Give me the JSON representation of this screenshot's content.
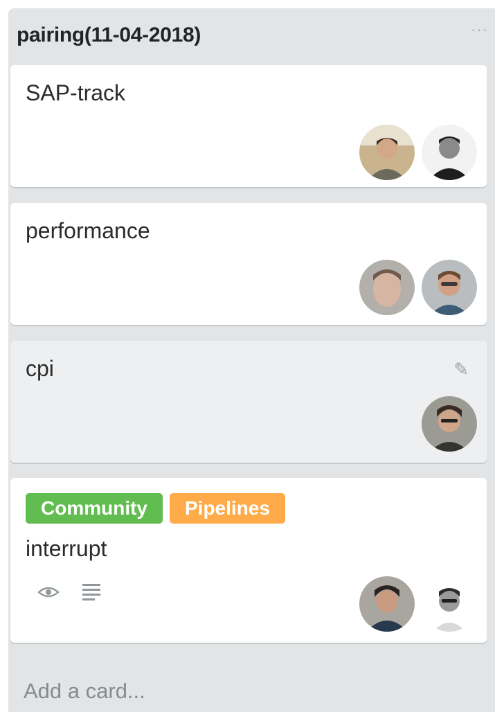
{
  "list": {
    "title": "pairing(11-04-2018)",
    "menu_icon": "ellipsis-icon",
    "add_card_label": "Add a card..."
  },
  "cards": [
    {
      "title": "SAP-track",
      "members": [
        "member-avatar",
        "member-avatar"
      ]
    },
    {
      "title": "performance",
      "members": [
        "member-avatar",
        "member-avatar"
      ]
    },
    {
      "title": "cpi",
      "members": [
        "member-avatar"
      ],
      "hovered": true,
      "edit_icon": "pencil-icon"
    },
    {
      "title": "interrupt",
      "labels": [
        {
          "text": "Community",
          "color": "#61bd4f"
        },
        {
          "text": "Pipelines",
          "color": "#ffab4a"
        }
      ],
      "badges": [
        "eye-icon",
        "description-icon"
      ],
      "members": [
        "member-avatar",
        "member-avatar"
      ]
    }
  ],
  "colors": {
    "list_background": "#e2e4e6",
    "card_background": "#ffffff",
    "card_hover_background": "#edeff0",
    "label_green": "#61bd4f",
    "label_orange": "#ffab4a"
  }
}
